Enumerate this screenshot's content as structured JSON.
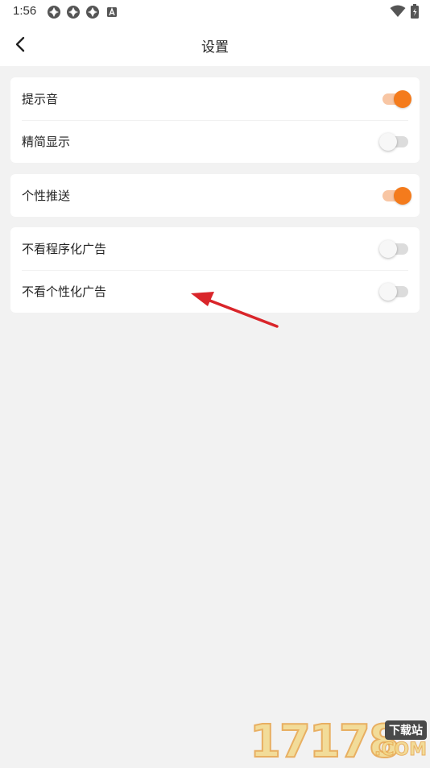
{
  "status_bar": {
    "time": "1:56",
    "left_icons": [
      "app-notification-icon",
      "app-notification-icon",
      "app-notification-icon",
      "a-badge-icon"
    ],
    "right_icons": [
      "wifi-icon",
      "battery-icon"
    ]
  },
  "header": {
    "title": "设置",
    "back_icon": "chevron-left-icon"
  },
  "groups": [
    {
      "items": [
        {
          "label": "提示音",
          "on": true
        },
        {
          "label": "精简显示",
          "on": false
        }
      ]
    },
    {
      "items": [
        {
          "label": "个性推送",
          "on": true
        }
      ]
    },
    {
      "items": [
        {
          "label": "不看程序化广告",
          "on": false
        },
        {
          "label": "不看个性化广告",
          "on": false
        }
      ]
    }
  ],
  "colors": {
    "accent": "#f47b1c",
    "accent_track": "#f8c6a4",
    "background": "#f2f2f2",
    "card": "#ffffff",
    "annotation_arrow": "#d9252a"
  },
  "watermark": {
    "digits": "17178",
    "badge": "下载站",
    "suffix": ".COM"
  }
}
